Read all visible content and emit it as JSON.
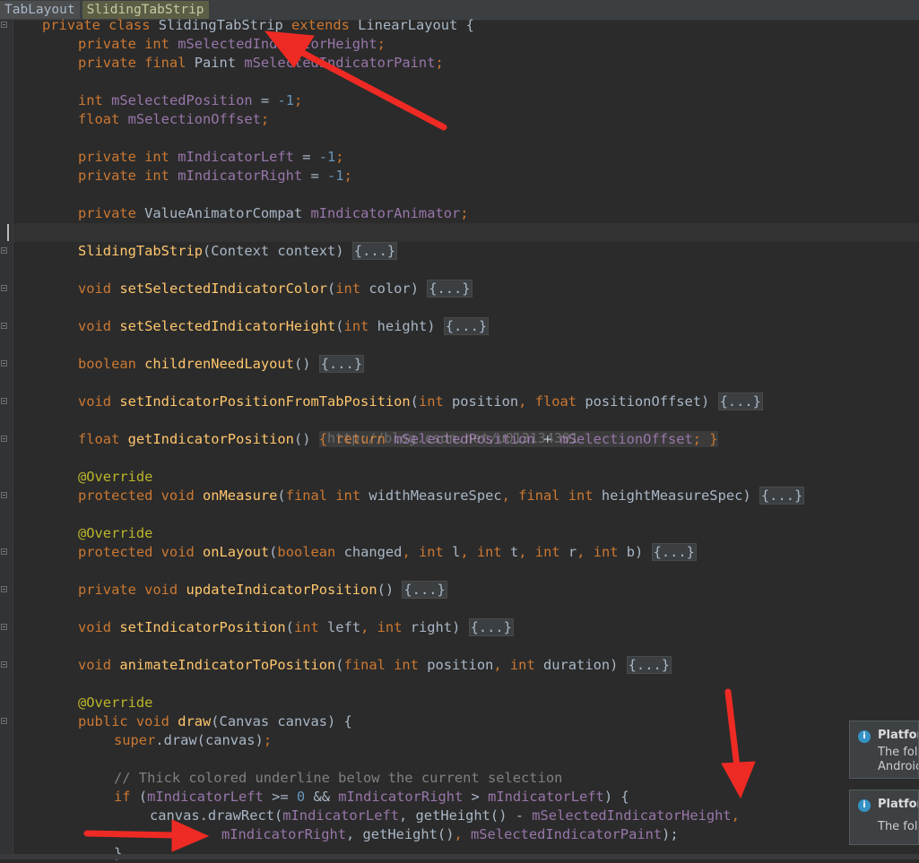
{
  "breadcrumb": {
    "items": [
      "TabLayout",
      "SlidingTabStrip"
    ]
  },
  "code": {
    "l0_a": "private class ",
    "l0_b": "SlidingTabStrip ",
    "l0_c": "extends ",
    "l0_d": "LinearLayout {",
    "l1_a": "private int ",
    "l1_b": "mSelectedIndicatorHeight",
    "l1_c": ";",
    "l2_a": "private final ",
    "l2_b": "Paint ",
    "l2_c": "mSelectedIndicatorPaint",
    "l2_d": ";",
    "l4_a": "int ",
    "l4_b": "mSelectedPosition",
    "l4_c": " = ",
    "l4_d": "-1",
    "l4_e": ";",
    "l5_a": "float ",
    "l5_b": "mSelectionOffset",
    "l5_c": ";",
    "l7_a": "private int ",
    "l7_b": "mIndicatorLeft",
    "l7_c": " = ",
    "l7_d": "-1",
    "l7_e": ";",
    "l8_a": "private int ",
    "l8_b": "mIndicatorRight",
    "l8_c": " = ",
    "l8_d": "-1",
    "l8_e": ";",
    "l10_a": "private ",
    "l10_b": "ValueAnimatorCompat ",
    "l10_c": "mIndicatorAnimator",
    "l10_d": ";",
    "l12_a": "SlidingTabStrip",
    "l12_b": "(Context context) ",
    "l14_a": "void ",
    "l14_b": "setSelectedIndicatorColor",
    "l14_c": "(",
    "l14_d": "int ",
    "l14_e": "color) ",
    "l16_a": "void ",
    "l16_b": "setSelectedIndicatorHeight",
    "l16_c": "(",
    "l16_d": "int ",
    "l16_e": "height) ",
    "l18_a": "boolean ",
    "l18_b": "childrenNeedLayout",
    "l18_c": "() ",
    "l20_a": "void ",
    "l20_b": "setIndicatorPositionFromTabPosition",
    "l20_c": "(",
    "l20_d": "int ",
    "l20_e": "position",
    "l20_f": ", ",
    "l20_g": "float ",
    "l20_h": "positionOffset) ",
    "l22_a": "float ",
    "l22_b": "getIndicatorPosition",
    "l22_c": "() ",
    "l22_d": "{ return ",
    "l22_e": "mSelectedPosition",
    "l22_f": " + ",
    "l22_g": "mSelectionOffset",
    "l22_h": "; }",
    "l24": "@Override",
    "l25_a": "protected void ",
    "l25_b": "onMeasure",
    "l25_c": "(",
    "l25_d": "final int ",
    "l25_e": "widthMeasureSpec",
    "l25_f": ", ",
    "l25_g": "final int ",
    "l25_h": "heightMeasureSpec) ",
    "l27": "@Override",
    "l28_a": "protected void ",
    "l28_b": "onLayout",
    "l28_c": "(",
    "l28_d": "boolean ",
    "l28_e": "changed",
    "l28_f": ", ",
    "l28_g": "int ",
    "l28_h": "l",
    "l28_i": ", ",
    "l28_j": "int ",
    "l28_k": "t",
    "l28_l": ", ",
    "l28_m": "int ",
    "l28_n": "r",
    "l28_o": ", ",
    "l28_p": "int ",
    "l28_q": "b) ",
    "l30_a": "private void ",
    "l30_b": "updateIndicatorPosition",
    "l30_c": "() ",
    "l32_a": "void ",
    "l32_b": "setIndicatorPosition",
    "l32_c": "(",
    "l32_d": "int ",
    "l32_e": "left",
    "l32_f": ", ",
    "l32_g": "int ",
    "l32_h": "right) ",
    "l34_a": "void ",
    "l34_b": "animateIndicatorToPosition",
    "l34_c": "(",
    "l34_d": "final int ",
    "l34_e": "position",
    "l34_f": ", ",
    "l34_g": "int ",
    "l34_h": "duration) ",
    "l36": "@Override",
    "l37_a": "public void ",
    "l37_b": "draw",
    "l37_c": "(Canvas canvas) {",
    "l38_a": "super",
    "l38_b": ".draw(canvas)",
    "l38_c": ";",
    "l40": "// Thick colored underline below the current selection",
    "l41_a": "if ",
    "l41_b": "(",
    "l41_c": "mIndicatorLeft",
    "l41_d": " >= ",
    "l41_e": "0",
    "l41_f": " && ",
    "l41_g": "mIndicatorRight",
    "l41_h": " > ",
    "l41_i": "mIndicatorLeft",
    "l41_j": ") {",
    "l42_a": "canvas.drawRect(",
    "l42_b": "mIndicatorLeft",
    "l42_c": ", getHeight() - ",
    "l42_d": "mSelectedIndicatorHeight",
    "l42_e": ",",
    "l43_a": "mIndicatorRight",
    "l43_b": ", getHeight()",
    "l43_c": ", ",
    "l43_d": "mSelectedIndicatorPaint",
    "l43_e": ");",
    "l44": "}",
    "fold": "{...}"
  },
  "watermark": "http://blog.csdn.net/u013134391",
  "notifications": [
    {
      "title": "Platforr",
      "line1": "The foll",
      "line2": "Androic"
    },
    {
      "title": "Platforr",
      "line1": "The foll"
    }
  ],
  "colors": {
    "background": "#2b2b2b",
    "keyword": "#cc7832",
    "field": "#9876aa",
    "method": "#ffc66d",
    "number": "#6897bb",
    "annotation_arrow": "#ee2a24"
  }
}
